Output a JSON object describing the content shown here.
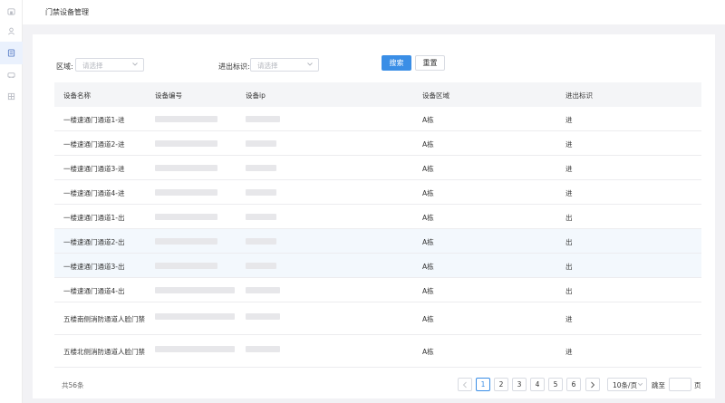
{
  "header": {
    "title": "门禁设备管理"
  },
  "filters": {
    "area_label": "区域:",
    "area_placeholder": "请选择",
    "direction_label": "进出标识:",
    "direction_placeholder": "请选择",
    "search_label": "搜索",
    "reset_label": "重置"
  },
  "table": {
    "columns": [
      "设备名称",
      "设备编号",
      "设备ip",
      "设备区域",
      "进出标识"
    ],
    "rows": [
      {
        "name": "一楼速通门通道1-进",
        "area": "A栋",
        "direction": "进"
      },
      {
        "name": "一楼速通门通道2-进",
        "area": "A栋",
        "direction": "进"
      },
      {
        "name": "一楼速通门通道3-进",
        "area": "A栋",
        "direction": "进"
      },
      {
        "name": "一楼速通门通道4-进",
        "area": "A栋",
        "direction": "进"
      },
      {
        "name": "一楼速通门通道1-出",
        "area": "A栋",
        "direction": "出"
      },
      {
        "name": "一楼速通门通道2-出",
        "area": "A栋",
        "direction": "出"
      },
      {
        "name": "一楼速通门通道3-出",
        "area": "A栋",
        "direction": "出"
      },
      {
        "name": "一楼速通门通道4-出",
        "area": "A栋",
        "direction": "出"
      },
      {
        "name": "五楼南侧消防通道人脸门禁",
        "area": "A栋",
        "direction": "进"
      },
      {
        "name": "五楼北侧消防通道人脸门禁",
        "area": "A栋",
        "direction": "进"
      }
    ]
  },
  "pagination": {
    "total_text": "共56条",
    "pages": [
      "1",
      "2",
      "3",
      "4",
      "5",
      "6"
    ],
    "current_page": "1",
    "page_size": "10条/页",
    "jump_prefix": "跳至",
    "jump_suffix": "页"
  },
  "colors": {
    "accent": "#3a8ee6",
    "row_highlight": "#f3f8fd"
  },
  "icons": {
    "sidebar": [
      "home-icon",
      "user-icon",
      "device-icon",
      "car-icon",
      "building-icon"
    ],
    "prev": "chevron-left-icon",
    "next": "chevron-right-icon"
  }
}
